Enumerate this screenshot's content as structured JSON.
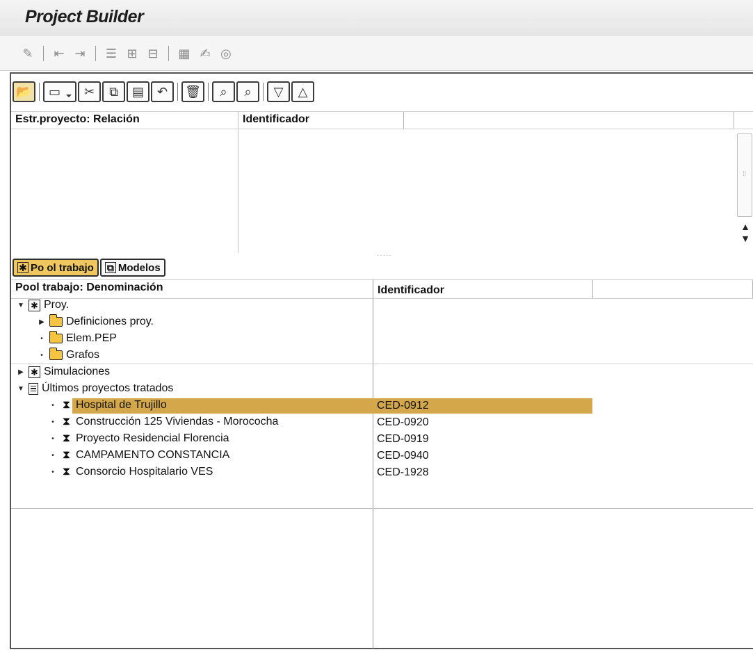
{
  "app": {
    "title": "Project Builder"
  },
  "app_toolbar": {
    "icons": [
      "settings-icon",
      "move-left-icon",
      "move-right-icon",
      "list-icon",
      "hierarchy-icon",
      "structure-icon",
      "table-icon",
      "edit-icon",
      "help-icon"
    ]
  },
  "structure_toolbar": {
    "icons": [
      "open-folder-icon",
      "new-document-icon",
      "cut-icon",
      "copy-icon",
      "paste-icon",
      "undo-icon",
      "delete-icon",
      "find-icon",
      "find-next-icon",
      "expand-icon",
      "collapse-icon"
    ]
  },
  "structure_header": {
    "col1": "Estr.proyecto: Relación",
    "col2": "Identificador",
    "col3": ""
  },
  "tabs": [
    {
      "label": "Po ol trabajo",
      "icon": "asterisk-icon",
      "active": true
    },
    {
      "label": "Modelos",
      "icon": "copy-icon",
      "active": false
    }
  ],
  "pool_header": {
    "col1": "Pool trabajo: Denominación",
    "col2": "Identificador",
    "col3": ""
  },
  "tree": {
    "proy": "Proy.",
    "definiciones": "Definiciones proy.",
    "elem_pep": "Elem.PEP",
    "grafos": "Grafos",
    "simulaciones": "Simulaciones",
    "ultimos": "Últimos proyectos tratados",
    "projects": [
      {
        "name": "Hospital de Trujillo",
        "id": "CED-0912",
        "selected": true
      },
      {
        "name": "Construcción 125 Viviendas - Morococha",
        "id": "CED-0920"
      },
      {
        "name": "Proyecto Residencial Florencia",
        "id": "CED-0919"
      },
      {
        "name": "CAMPAMENTO CONSTANCIA",
        "id": "CED-0940"
      },
      {
        "name": "Consorcio Hospitalario VES",
        "id": "CED-1928"
      }
    ]
  },
  "colors": {
    "selected_row": "#d4a84a",
    "active_tab": "#f0c75e",
    "folder": "#f5c542"
  }
}
